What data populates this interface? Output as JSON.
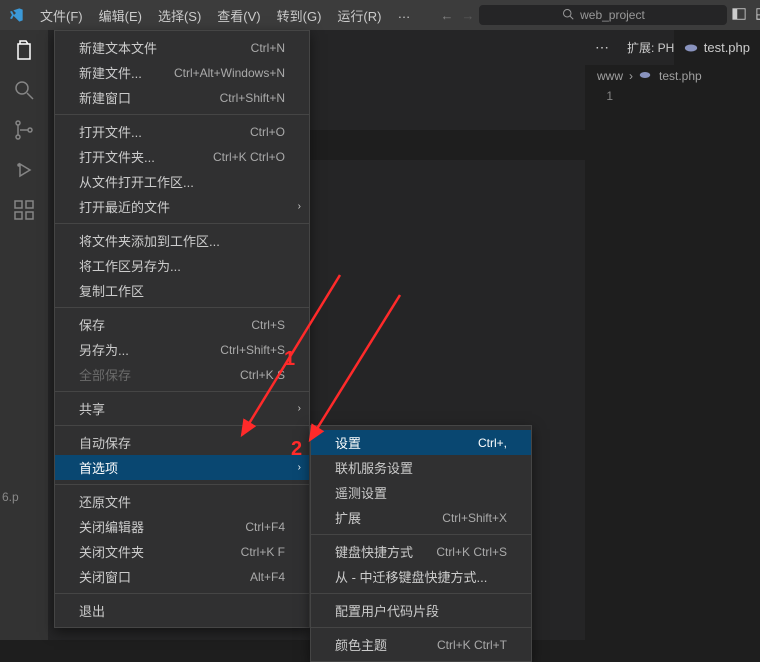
{
  "titlebar": {
    "menus": [
      "文件(F)",
      "编辑(E)",
      "选择(S)",
      "查看(V)",
      "转到(G)",
      "运行(R)"
    ],
    "ellipsis": "…",
    "search_label": "web_project"
  },
  "tabs": {
    "ext_label": "扩展: PHP Server",
    "active_tab": "test.php"
  },
  "breadcrumb": {
    "root": "www",
    "file": "test.php"
  },
  "gutter": {
    "line1": "1"
  },
  "bg_filename": "6.p",
  "file_menu": {
    "groups": [
      [
        {
          "label": "新建文本文件",
          "shortcut": "Ctrl+N"
        },
        {
          "label": "新建文件...",
          "shortcut": "Ctrl+Alt+Windows+N"
        },
        {
          "label": "新建窗口",
          "shortcut": "Ctrl+Shift+N"
        }
      ],
      [
        {
          "label": "打开文件...",
          "shortcut": "Ctrl+O"
        },
        {
          "label": "打开文件夹...",
          "shortcut": "Ctrl+K Ctrl+O"
        },
        {
          "label": "从文件打开工作区..."
        },
        {
          "label": "打开最近的文件",
          "submenu": true
        }
      ],
      [
        {
          "label": "将文件夹添加到工作区..."
        },
        {
          "label": "将工作区另存为..."
        },
        {
          "label": "复制工作区"
        }
      ],
      [
        {
          "label": "保存",
          "shortcut": "Ctrl+S"
        },
        {
          "label": "另存为...",
          "shortcut": "Ctrl+Shift+S"
        },
        {
          "label": "全部保存",
          "shortcut": "Ctrl+K S",
          "disabled": true
        }
      ],
      [
        {
          "label": "共享",
          "submenu": true
        }
      ],
      [
        {
          "label": "自动保存"
        },
        {
          "label": "首选项",
          "submenu": true,
          "highlighted": true
        }
      ],
      [
        {
          "label": "还原文件"
        },
        {
          "label": "关闭编辑器",
          "shortcut": "Ctrl+F4"
        },
        {
          "label": "关闭文件夹",
          "shortcut": "Ctrl+K F"
        },
        {
          "label": "关闭窗口",
          "shortcut": "Alt+F4"
        }
      ],
      [
        {
          "label": "退出"
        }
      ]
    ]
  },
  "submenu": {
    "groups": [
      [
        {
          "label": "设置",
          "shortcut": "Ctrl+,",
          "highlighted": true
        },
        {
          "label": "联机服务设置"
        },
        {
          "label": "遥测设置"
        },
        {
          "label": "扩展",
          "shortcut": "Ctrl+Shift+X"
        }
      ],
      [
        {
          "label": "键盘快捷方式",
          "shortcut": "Ctrl+K Ctrl+S"
        },
        {
          "label": "从 - 中迁移键盘快捷方式..."
        }
      ],
      [
        {
          "label": "配置用户代码片段"
        }
      ],
      [
        {
          "label": "颜色主题",
          "shortcut": "Ctrl+K Ctrl+T"
        }
      ]
    ]
  },
  "annotations": {
    "one": "1",
    "two": "2"
  }
}
